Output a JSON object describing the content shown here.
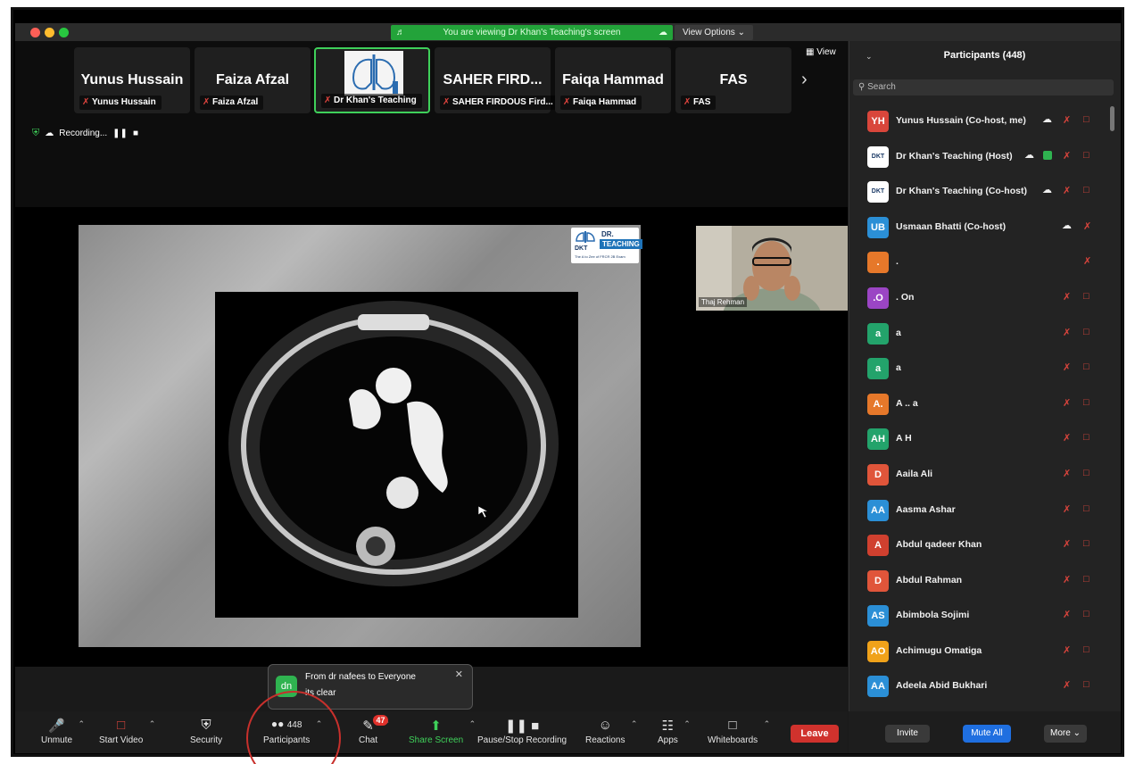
{
  "banner": {
    "text": "You are viewing Dr Khan's Teaching's screen",
    "view_options": "View Options"
  },
  "gallery": {
    "view_label": "View",
    "tiles": [
      {
        "big": "Yunus Hussain",
        "small": "Yunus Hussain"
      },
      {
        "big": "Faiza Afzal",
        "small": "Faiza Afzal"
      },
      {
        "big": "",
        "small": "Dr Khan's Teaching"
      },
      {
        "big": "SAHER FIRD...",
        "small": "SAHER FIRDOUS Fird..."
      },
      {
        "big": "Faiqa Hammad",
        "small": "Faiqa Hammad"
      },
      {
        "big": "FAS",
        "small": "FAS"
      }
    ]
  },
  "recording": {
    "label": "Recording..."
  },
  "slide": {
    "logo_line1": "DR. KHAN'S",
    "logo_line2": "TEACHING",
    "logo_abbr": "DKT",
    "logo_tagline": "The A to Zee of FRCR 2B Exam"
  },
  "video": {
    "name": "Thaj Rehman"
  },
  "chat_toast": {
    "avatar": "dn",
    "from": "From dr nafees to Everyone",
    "message": "its clear"
  },
  "toolbar": {
    "unmute": "Unmute",
    "start_video": "Start Video",
    "security": "Security",
    "participants": "Participants",
    "participants_count": "448",
    "chat": "Chat",
    "chat_badge": "47",
    "share_screen": "Share Screen",
    "pause_recording": "Pause/Stop Recording",
    "reactions": "Reactions",
    "apps": "Apps",
    "whiteboards": "Whiteboards",
    "leave": "Leave"
  },
  "panel": {
    "title": "Participants (448)",
    "search_placeholder": "Search",
    "participants": [
      {
        "initials": "YH",
        "name": "Yunus Hussain (Co-host, me)",
        "color": "#d9463b"
      },
      {
        "initials": "DKT",
        "name": "Dr Khan's Teaching (Host)",
        "color": "#ffffff"
      },
      {
        "initials": "DKT",
        "name": "Dr Khan's Teaching (Co-host)",
        "color": "#ffffff"
      },
      {
        "initials": "UB",
        "name": "Usmaan Bhatti (Co-host)",
        "color": "#2b8fd6"
      },
      {
        "initials": ".",
        "name": ".",
        "color": "#e6782a"
      },
      {
        "initials": ".O",
        "name": ". On",
        "color": "#9b45c4"
      },
      {
        "initials": "a",
        "name": "a",
        "color": "#23a36b"
      },
      {
        "initials": "a",
        "name": "a",
        "color": "#23a36b"
      },
      {
        "initials": "A.",
        "name": "A .. a",
        "color": "#e6782a"
      },
      {
        "initials": "AH",
        "name": "A H",
        "color": "#23a36b"
      },
      {
        "initials": "D",
        "name": "Aaila Ali",
        "color": "#e0553a"
      },
      {
        "initials": "AA",
        "name": "Aasma Ashar",
        "color": "#2b8fd6"
      },
      {
        "initials": "A",
        "name": "Abdul qadeer Khan",
        "color": "#d0402f"
      },
      {
        "initials": "D",
        "name": "Abdul Rahman",
        "color": "#e0553a"
      },
      {
        "initials": "AS",
        "name": "Abimbola Sojimi",
        "color": "#2b8fd6"
      },
      {
        "initials": "AO",
        "name": "Achimugu Omatiga",
        "color": "#f0a21a"
      },
      {
        "initials": "AA",
        "name": "Adeela Abid Bukhari",
        "color": "#2b8fd6"
      }
    ],
    "invite": "Invite",
    "mute_all": "Mute All",
    "more": "More"
  },
  "colors": {
    "accent_green": "#23a33a",
    "leave_red": "#d0322d",
    "mute_all_blue": "#1f6fe0"
  }
}
